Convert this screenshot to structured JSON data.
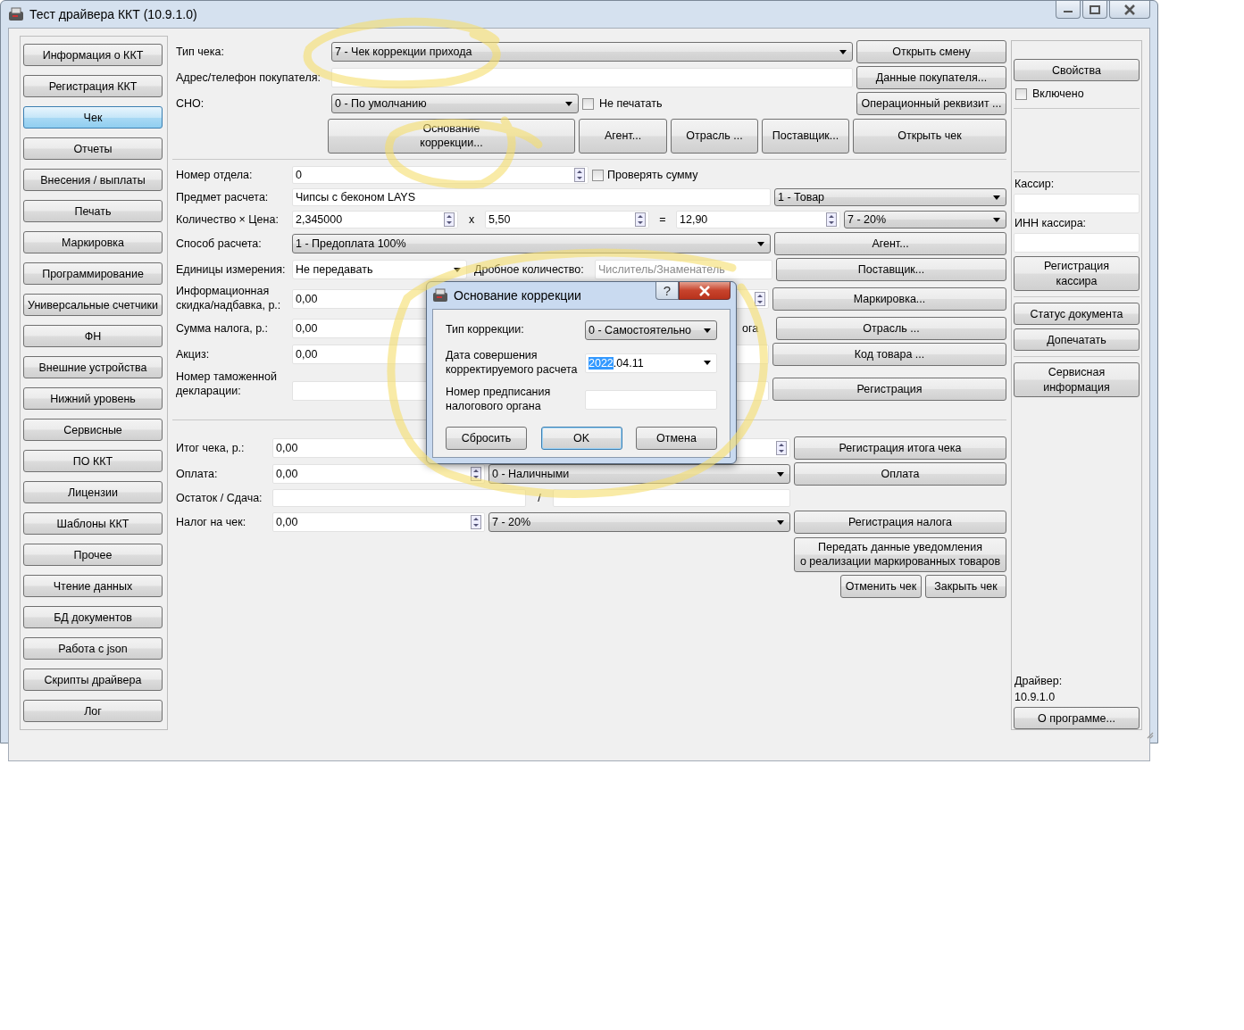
{
  "window": {
    "title": "Тест драйвера ККТ (10.9.1.0)"
  },
  "nav": [
    {
      "label": "Информация о ККТ",
      "selected": false
    },
    {
      "label": "Регистрация ККТ",
      "selected": false
    },
    {
      "label": "Чек",
      "selected": true
    },
    {
      "label": "Отчеты",
      "selected": false
    },
    {
      "label": "Внесения / выплаты",
      "selected": false
    },
    {
      "label": "Печать",
      "selected": false
    },
    {
      "label": "Маркировка",
      "selected": false
    },
    {
      "label": "Программирование",
      "selected": false
    },
    {
      "label": "Универсальные счетчики",
      "selected": false
    },
    {
      "label": "ФН",
      "selected": false
    },
    {
      "label": "Внешние устройства",
      "selected": false
    },
    {
      "label": "Нижний уровень",
      "selected": false
    },
    {
      "label": "Сервисные",
      "selected": false
    },
    {
      "label": "ПО ККТ",
      "selected": false
    },
    {
      "label": "Лицензии",
      "selected": false
    },
    {
      "label": "Шаблоны ККТ",
      "selected": false
    },
    {
      "label": "Прочее",
      "selected": false
    },
    {
      "label": "Чтение данных",
      "selected": false
    },
    {
      "label": "БД документов",
      "selected": false
    },
    {
      "label": "Работа с json",
      "selected": false
    },
    {
      "label": "Скрипты драйвера",
      "selected": false
    },
    {
      "label": "Лог",
      "selected": false
    }
  ],
  "receipt": {
    "type": {
      "label": "Тип чека:",
      "value": "7 - Чек коррекции прихода"
    },
    "open_shift_button": "Открыть смену",
    "buyer": {
      "label": "Адрес/телефон покупателя:"
    },
    "buyer_button": "Данные покупателя...",
    "sno": {
      "label": "СНО:",
      "value": "0 - По умолчанию"
    },
    "no_print": {
      "label": "Не печатать",
      "checked": false
    },
    "operational_button": "Операционный реквизит ...",
    "action_buttons": [
      "Основание\nкоррекции...",
      "Агент...",
      "Отрасль ...",
      "Поставщик...",
      "Открыть чек"
    ]
  },
  "item": {
    "department": {
      "label": "Номер отдела:",
      "value": "0"
    },
    "check_sum": {
      "label": "Проверять сумму",
      "checked": false
    },
    "subject": {
      "label": "Предмет расчета:",
      "value": "Чипсы с беконом LAYS",
      "type": "1 - Товар"
    },
    "quantity": {
      "label": "Количество × Цена:",
      "quantity": "2,345000",
      "times": "x",
      "price": "5,50",
      "equals": "=",
      "sum": "12,90",
      "tax": "7 - 20%"
    },
    "method": {
      "label": "Способ расчета:",
      "value": "1 - Предоплата 100%",
      "button": "Агент..."
    },
    "units": {
      "label": "Единицы измерения:",
      "value": "Не передавать",
      "fraction_label": "Дробное количество:",
      "fraction_placeholder": "Числитель/Знаменатель",
      "button": "Поставщик..."
    },
    "discount": {
      "label": "Информационная\nскидка/надбавка, р.:",
      "value": "0,00",
      "button": "Маркировка..."
    },
    "tax_sum": {
      "label": "Сумма налога, р.:",
      "value": "0,00",
      "label_fragment": "ога",
      "button": "Отрасль ..."
    },
    "excise": {
      "label": "Акциз:",
      "value": "0,00",
      "button": "Код товара ..."
    },
    "customs": {
      "label": "Номер таможенной\nдекларации:",
      "button": "Регистрация"
    }
  },
  "totals": {
    "total": {
      "label": "Итог чека, р.:",
      "value": "0,00",
      "button": "Регистрация итога чека"
    },
    "payment": {
      "label": "Оплата:",
      "value": "0,00",
      "type": "0 - Наличными",
      "button": "Оплата"
    },
    "change": {
      "label": "Остаток / Сдача:",
      "separator": "/"
    },
    "tax": {
      "label": "Налог на чек:",
      "value": "0,00",
      "type": "7 - 20%",
      "button": "Регистрация налога"
    },
    "notify_button": "Передать данные уведомления\nо реализации маркированных товаров",
    "cancel_button": "Отменить чек",
    "close_button": "Закрыть чек"
  },
  "side": {
    "properties_button": "Свойства",
    "enabled": {
      "label": "Включено",
      "checked": false
    },
    "cashier_label": "Кассир:",
    "inn_label": "ИНН кассира:",
    "register_cashier_button": "Регистрация\nкассира",
    "status_button": "Статус документа",
    "reprint_button": "Допечатать",
    "service_button": "Сервисная\nинформация",
    "driver_label": "Драйвер:",
    "driver_version": "10.9.1.0",
    "about_button": "О программе..."
  },
  "dialog": {
    "title": "Основание коррекции",
    "help": "?",
    "correction_type": {
      "label": "Тип коррекции:",
      "value": "0 - Самостоятельно"
    },
    "date": {
      "label": "Дата совершения\nкорректируемого расчета",
      "selected_part": "2022",
      "rest": ".04.11"
    },
    "order": {
      "label": "Номер предписания\nналогового органа"
    },
    "buttons": [
      {
        "label": "Сбросить",
        "default": false
      },
      {
        "label": "OK",
        "default": true
      },
      {
        "label": "Отмена",
        "default": false
      }
    ]
  }
}
